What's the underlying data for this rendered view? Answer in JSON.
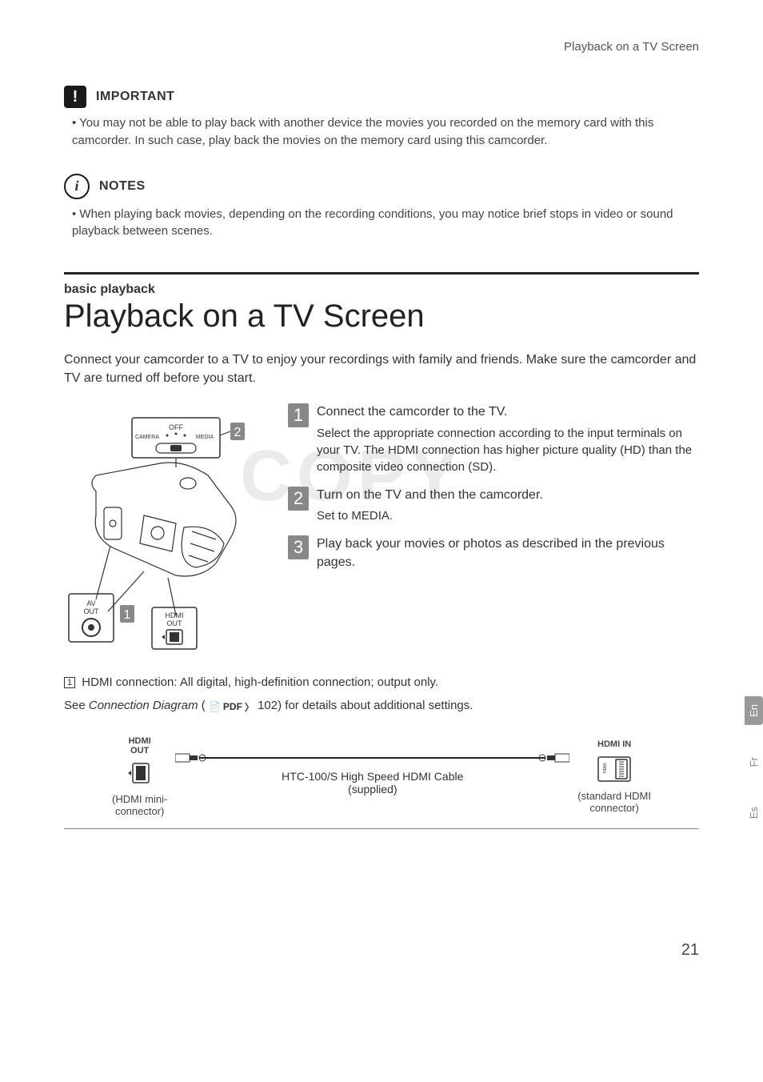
{
  "header": "Playback on a TV Screen",
  "important": {
    "label": "IMPORTANT",
    "text": "You may not be able to play back with another device the movies you recorded on the memory card with this camcorder. In such case, play back the movies on the memory card using this camcorder."
  },
  "notes": {
    "label": "NOTES",
    "text": "When playing back movies, depending on the recording conditions, you may notice brief stops in video or sound playback between scenes."
  },
  "section": {
    "subtitle": "basic playback",
    "title": "Playback on a TV Screen",
    "intro": "Connect your camcorder to a TV to enjoy your recordings with family and friends. Make sure the camcorder and TV are turned off before you start."
  },
  "watermark": "COPY",
  "diagram": {
    "switch_off": "OFF",
    "switch_camera": "CAMERA",
    "switch_media": "MEDIA",
    "av_out": "AV\nOUT",
    "hdmi_out": "HDMI\nOUT",
    "callout1": "1",
    "callout2": "2"
  },
  "steps": [
    {
      "num": "1",
      "title": "Connect the camcorder to the TV.",
      "body": "Select the appropriate connection according to the input terminals on your TV. The HDMI connection has higher picture quality (HD) than the composite video connection (SD)."
    },
    {
      "num": "2",
      "title": "Turn on the TV and then the camcorder.",
      "body": "Set to MEDIA."
    },
    {
      "num": "3",
      "title": "Play back your movies or photos as described in the previous pages.",
      "body": ""
    }
  ],
  "hdmi_note": {
    "ref": "1",
    "text": "HDMI connection: All digital, high-definition connection; output only."
  },
  "see": {
    "prefix": "See ",
    "italic": "Connection Diagram",
    "mid": " ( ",
    "pdf": "PDF",
    "page_ref": " 102) for details about additional settings."
  },
  "connection": {
    "left_label": "HDMI\nOUT",
    "left_caption": "(HDMI mini-\nconnector)",
    "cable": "HTC-100/S High Speed HDMI Cable",
    "supplied": "(supplied)",
    "right_label": "HDMI IN",
    "right_caption": "(standard HDMI\nconnector)"
  },
  "page_number": "21",
  "lang_tabs": {
    "en": "En",
    "fr": "Fr",
    "es": "Es"
  }
}
